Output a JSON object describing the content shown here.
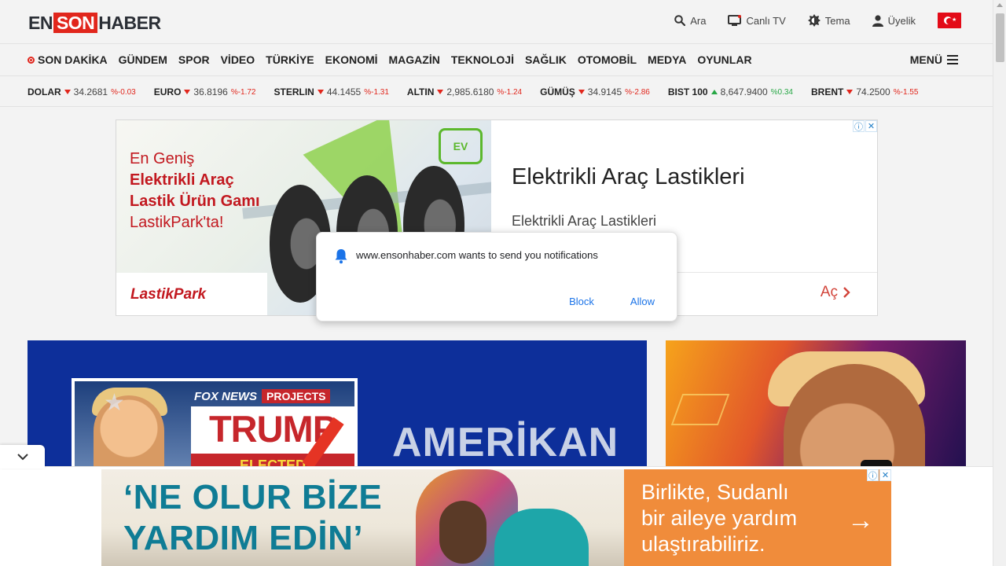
{
  "header": {
    "logo": {
      "part1": "EN",
      "part2": "SON",
      "part3": "HABER"
    },
    "search_label": "Ara",
    "live_tv_label": "Canlı TV",
    "theme_label": "Tema",
    "membership_label": "Üyelik"
  },
  "nav": {
    "items": [
      "SON DAKİKA",
      "GÜNDEM",
      "SPOR",
      "VİDEO",
      "TÜRKİYE",
      "EKONOMİ",
      "MAGAZİN",
      "TEKNOLOJİ",
      "SAĞLIK",
      "OTOMOBİL",
      "MEDYA",
      "OYUNLAR"
    ],
    "menu_label": "MENÜ"
  },
  "tickers": [
    {
      "name": "DOLAR",
      "value": "34.2681",
      "change": "%-0.03",
      "direction": "down"
    },
    {
      "name": "EURO",
      "value": "36.8196",
      "change": "%-1.72",
      "direction": "down"
    },
    {
      "name": "STERLIN",
      "value": "44.1455",
      "change": "%-1.31",
      "direction": "down"
    },
    {
      "name": "ALTIN",
      "value": "2,985.6180",
      "change": "%-1.24",
      "direction": "down"
    },
    {
      "name": "GÜMÜŞ",
      "value": "34.9145",
      "change": "%-2.86",
      "direction": "down"
    },
    {
      "name": "BIST 100",
      "value": "8,647.9400",
      "change": "%0.34",
      "direction": "up"
    },
    {
      "name": "BRENT",
      "value": "74.2500",
      "change": "%-1.55",
      "direction": "down"
    }
  ],
  "ad_top": {
    "img_line1": "En Geniş",
    "img_line2": "Elektrikli Araç",
    "img_line3": "Lastik Ürün Gamı",
    "img_line4": "LastikPark'ta!",
    "ev_badge": "EV",
    "brand": "LastikPark",
    "title": "Elektrikli Araç Lastikleri",
    "subtitle": "Elektrikli Araç Lastikleri",
    "cta": "Aç"
  },
  "hero": {
    "fox_label": "FOX NEWS",
    "projects_label": "PROJECTS",
    "trump_label": "TRUMP",
    "elected_label": "ELECTED",
    "title": "AMERİKAN"
  },
  "notification": {
    "message": "www.ensonhaber.com wants to send you notifications",
    "block_label": "Block",
    "allow_label": "Allow"
  },
  "ad_bottom": {
    "line1": "‘NE OLUR BİZE",
    "line2": "YARDIM EDİN’",
    "right_line1": "Birlikte, Sudanlı",
    "right_line2": "bir aileye yardım",
    "right_line3": "ulaştırabiliriz."
  },
  "colors": {
    "brand_red": "#e1261c",
    "link_blue": "#1a73e8",
    "hero_blue": "#0d2f9a",
    "ad_orange": "#f08c3b",
    "ad_teal": "#0f7c95"
  }
}
